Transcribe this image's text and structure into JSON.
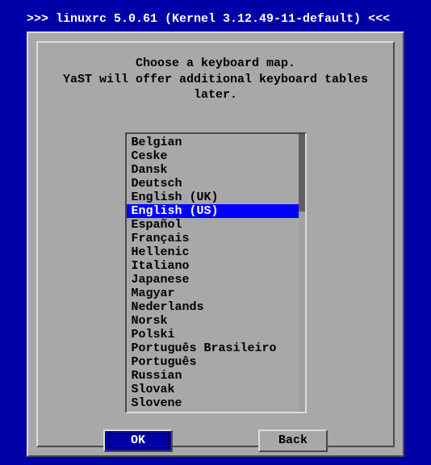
{
  "title": ">>> linuxrc 5.0.61 (Kernel 3.12.49-11-default) <<<",
  "prompt": {
    "line1": "Choose a keyboard map.",
    "line2": "YaST will offer additional keyboard tables later."
  },
  "keymaps": [
    "Belgian",
    "Ceske",
    "Dansk",
    "Deutsch",
    "English (UK)",
    "English (US)",
    "Español",
    "Français",
    "Hellenic",
    "Italiano",
    "Japanese",
    "Magyar",
    "Nederlands",
    "Norsk",
    "Polski",
    "Português Brasileiro",
    "Português",
    "Russian",
    "Slovak",
    "Slovene"
  ],
  "selected_index": 5,
  "scroll": {
    "thumb_top_pct": 0,
    "thumb_height_pct": 28
  },
  "buttons": {
    "ok": "OK",
    "back": "Back"
  }
}
